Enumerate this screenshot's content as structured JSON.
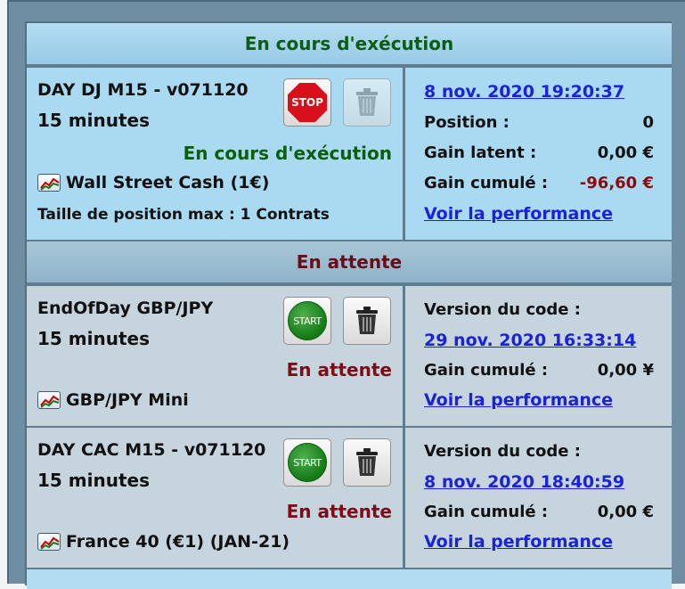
{
  "sections": {
    "running_header": "En cours d'exécution",
    "waiting_header": "En attente"
  },
  "running_card": {
    "name": "DAY DJ M15 - v071120",
    "period": "15 minutes",
    "status": "En cours d'exécution",
    "instrument": "Wall Street Cash (1€)",
    "max_position": "Taille de position max : 1 Contrats",
    "stop_button_label": "STOP",
    "date_link": "8 nov. 2020 19:20:37",
    "position_label": "Position :",
    "position_value": "0",
    "latent_gain_label": "Gain latent :",
    "latent_gain_value": "0,00 €",
    "cumulative_gain_label": "Gain cumulé :",
    "cumulative_gain_value": "-96,60 €",
    "performance_link": "Voir la performance"
  },
  "waiting_cards": [
    {
      "name": "EndOfDay GBP/JPY",
      "period": "15 minutes",
      "status": "En attente",
      "instrument": "GBP/JPY Mini",
      "start_button_label": "START",
      "code_version_label": "Version du code :",
      "date_link": "29 nov. 2020 16:33:14",
      "cumulative_gain_label": "Gain cumulé :",
      "cumulative_gain_value": "0,00 ¥",
      "performance_link": "Voir la performance"
    },
    {
      "name": "DAY CAC M15 - v071120",
      "period": "15 minutes",
      "status": "En attente",
      "instrument": "France 40 (€1) (JAN-21)",
      "start_button_label": "START",
      "code_version_label": "Version du code :",
      "date_link": "8 nov. 2020 18:40:59",
      "cumulative_gain_label": "Gain cumulé :",
      "cumulative_gain_value": "0,00 €",
      "performance_link": "Voir la performance"
    }
  ],
  "icons": {
    "stop": "stop-icon",
    "start": "start-icon",
    "trash": "trash-icon",
    "instrument": "chart-icon"
  },
  "colors": {
    "running_text": "#0b5d10",
    "waiting_text": "#7a0d16",
    "negative": "#8b0a12",
    "link": "#1b22d8"
  }
}
